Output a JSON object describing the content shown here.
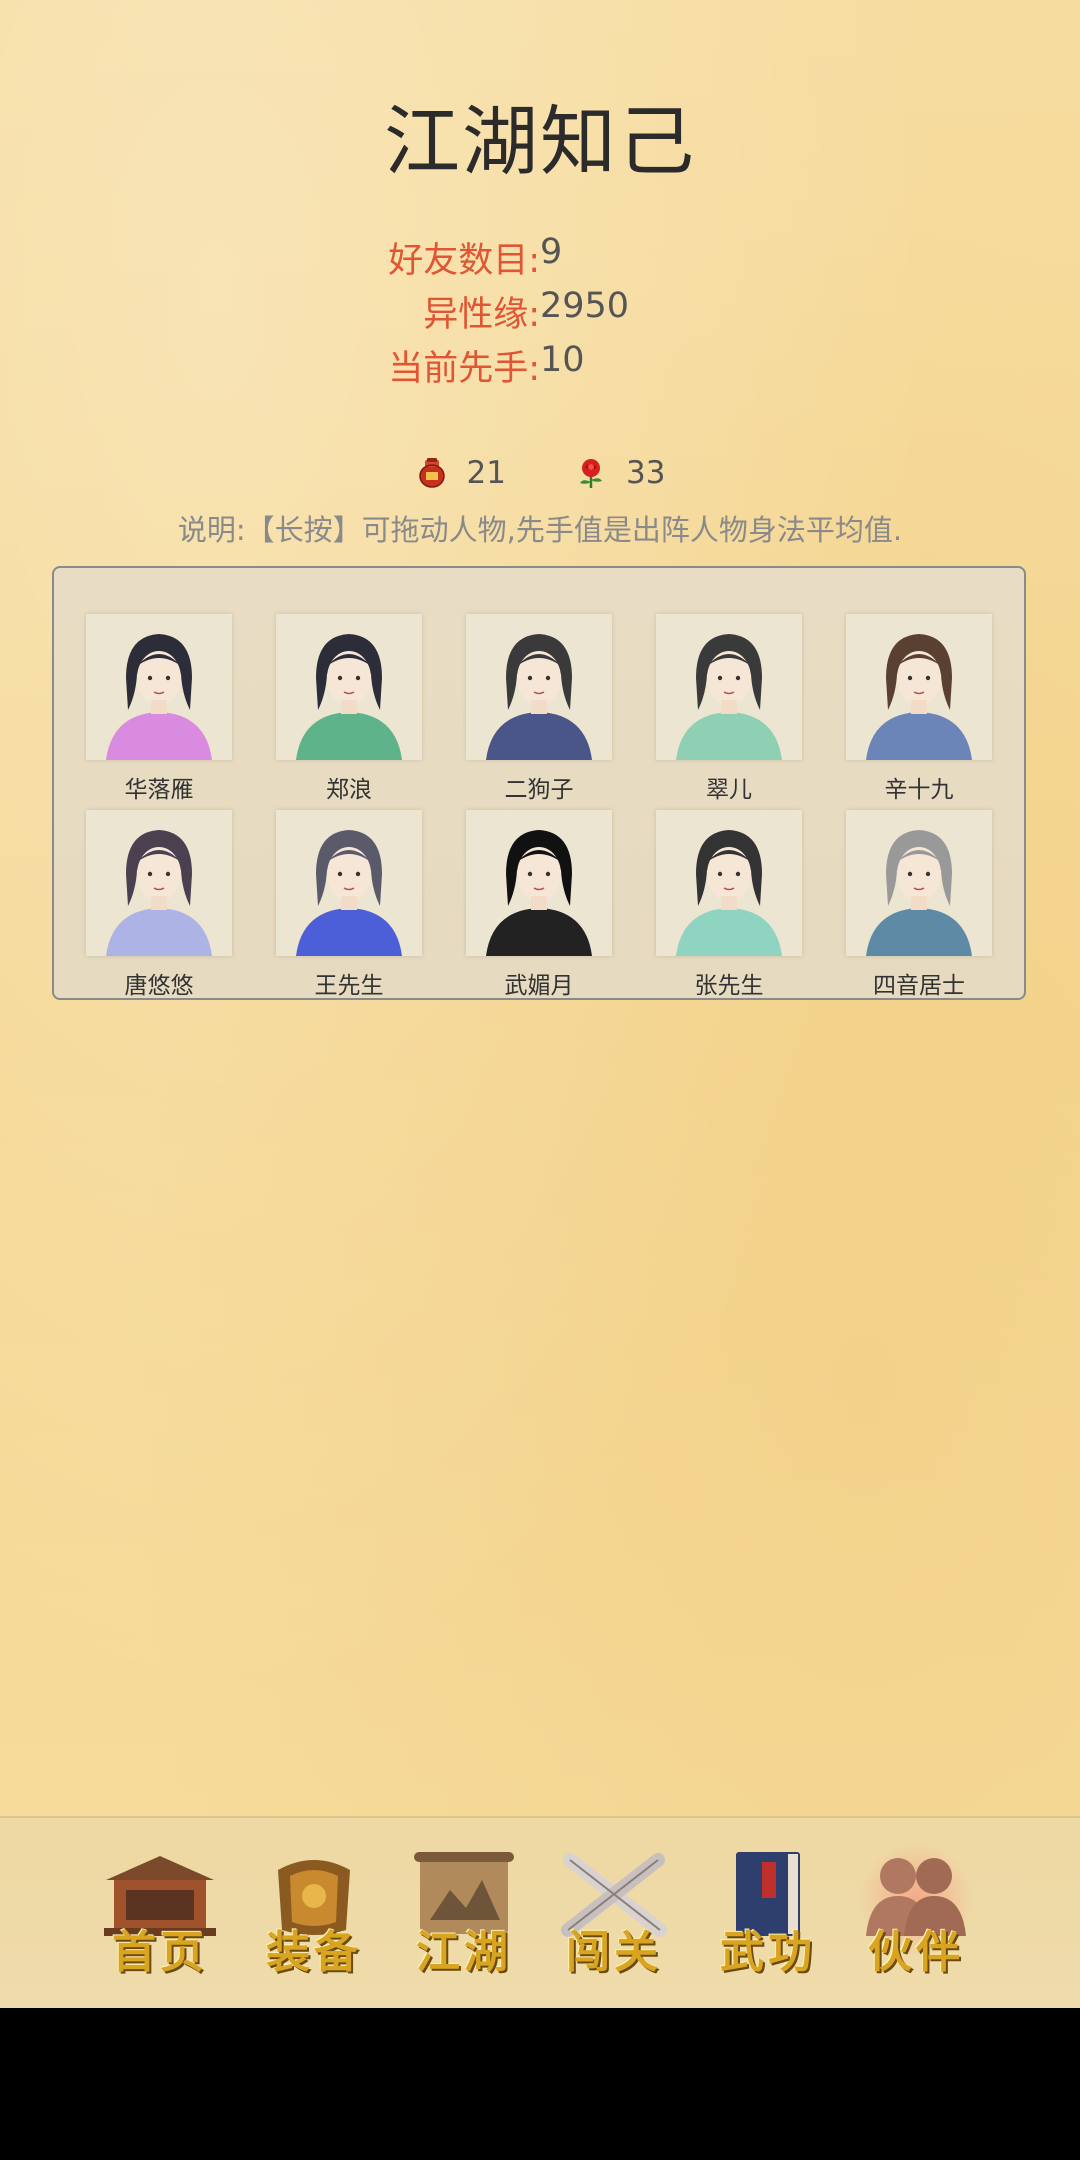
{
  "title": "江湖知己",
  "stats": [
    {
      "label": "好友数目:",
      "value": "9"
    },
    {
      "label": "异性缘:",
      "value": "2950"
    },
    {
      "label": "当前先手:",
      "value": "10"
    }
  ],
  "resources": [
    {
      "icon": "wine-jar-icon",
      "value": "21"
    },
    {
      "icon": "rose-icon",
      "value": "33"
    }
  ],
  "note": "说明:【长按】可拖动人物,先手值是出阵人物身法平均值.",
  "characters": [
    {
      "name": "华落雁",
      "robe": "#d98be0",
      "hair": "#2d2d3a"
    },
    {
      "name": "郑浪",
      "robe": "#5fb38a",
      "hair": "#2d2d3a"
    },
    {
      "name": "二狗子",
      "robe": "#4a5688",
      "hair": "#3a3a3a"
    },
    {
      "name": "翠儿",
      "robe": "#8fd0b5",
      "hair": "#3a3a3a"
    },
    {
      "name": "辛十九",
      "robe": "#6c85b8",
      "hair": "#5a4030"
    },
    {
      "name": "唐悠悠",
      "robe": "#aeb3e6",
      "hair": "#4a4050"
    },
    {
      "name": "王先生",
      "robe": "#4d5fd8",
      "hair": "#5a5a6a"
    },
    {
      "name": "武媚月",
      "robe": "#222222",
      "hair": "#111111"
    },
    {
      "name": "张先生",
      "robe": "#8fd4c0",
      "hair": "#333333"
    },
    {
      "name": "四音居士",
      "robe": "#5e8aa5",
      "hair": "#999999"
    }
  ],
  "nav": [
    {
      "label": "首页",
      "icon": "home-pavilion-icon",
      "active": false
    },
    {
      "label": "装备",
      "icon": "armor-icon",
      "active": false
    },
    {
      "label": "江湖",
      "icon": "map-scroll-icon",
      "active": false
    },
    {
      "label": "闯关",
      "icon": "crossed-swords-icon",
      "active": false
    },
    {
      "label": "武功",
      "icon": "martial-book-icon",
      "active": false
    },
    {
      "label": "伙伴",
      "icon": "companions-icon",
      "active": true
    }
  ]
}
